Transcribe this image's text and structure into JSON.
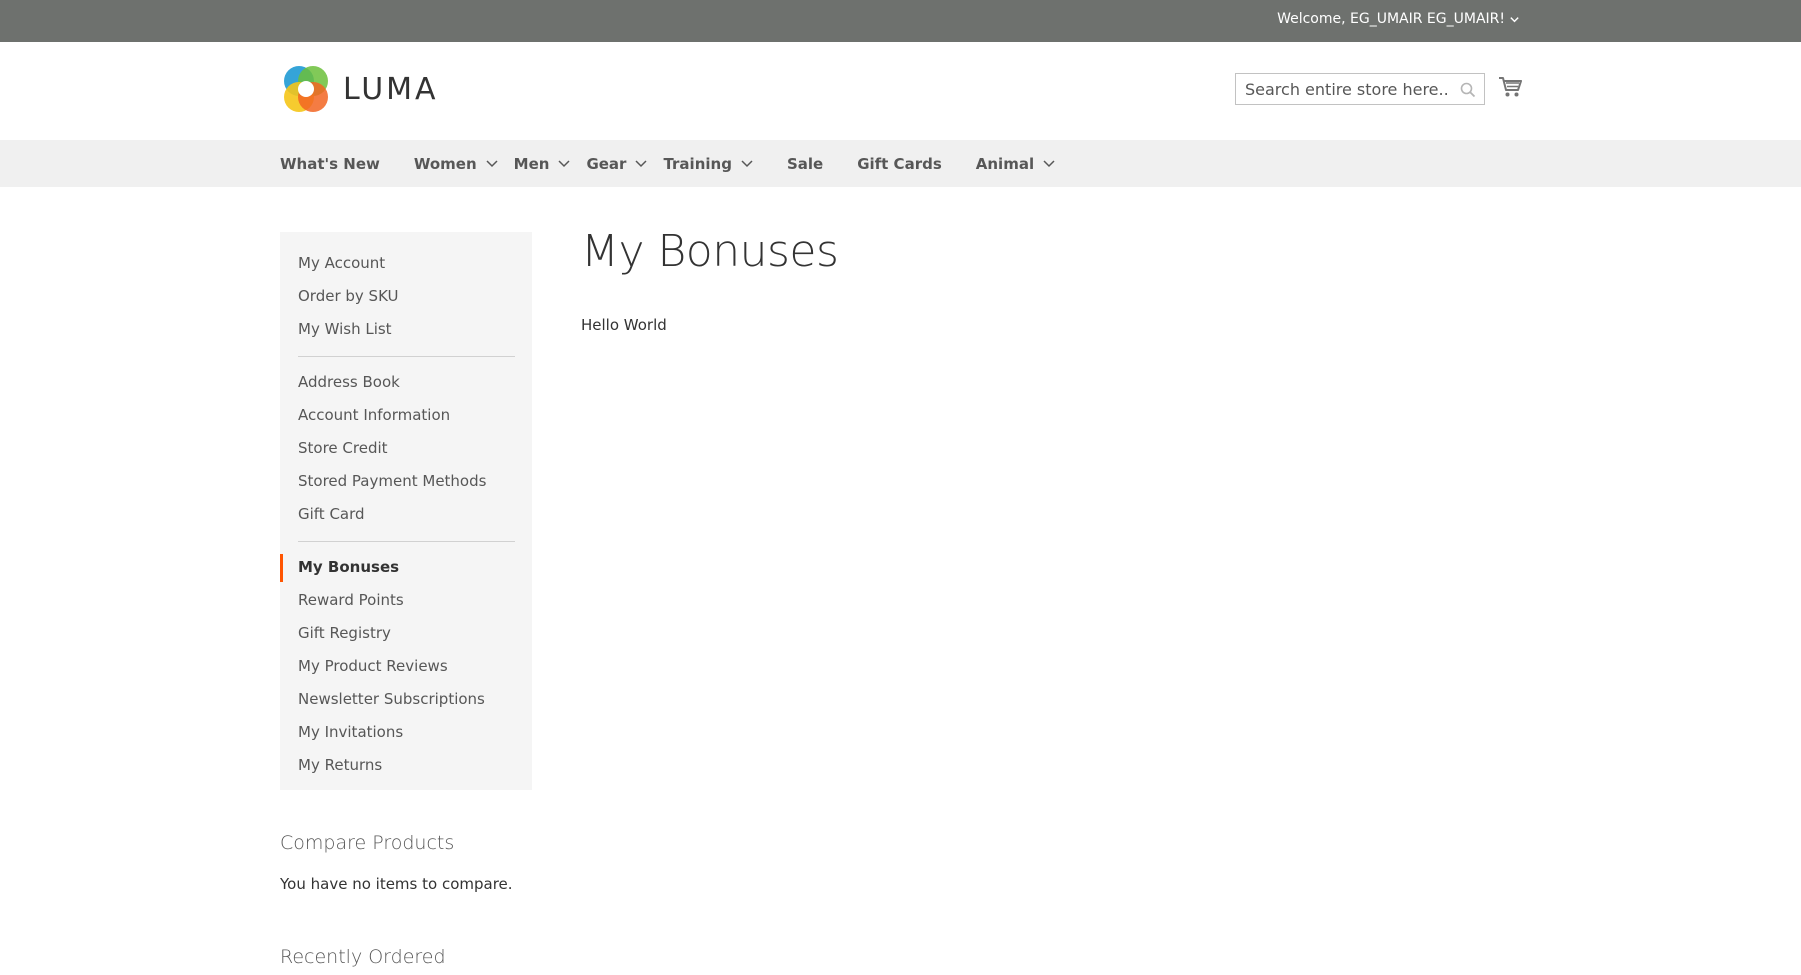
{
  "topbar": {
    "welcome": "Welcome, EG_UMAIR EG_UMAIR!"
  },
  "header": {
    "logo_text": "LUMA",
    "search_placeholder": "Search entire store here..."
  },
  "nav": {
    "items": [
      {
        "label": "What's New"
      },
      {
        "label": "Women"
      },
      {
        "label": "Men"
      },
      {
        "label": "Gear"
      },
      {
        "label": "Training"
      },
      {
        "label": "Sale"
      },
      {
        "label": "Gift Cards"
      },
      {
        "label": "Animal"
      }
    ]
  },
  "sidebar": {
    "group1": [
      {
        "label": "My Account"
      },
      {
        "label": "Order by SKU"
      },
      {
        "label": "My Wish List"
      }
    ],
    "group2": [
      {
        "label": "Address Book"
      },
      {
        "label": "Account Information"
      },
      {
        "label": "Store Credit"
      },
      {
        "label": "Stored Payment Methods"
      },
      {
        "label": "Gift Card"
      }
    ],
    "group3": [
      {
        "label": "My Bonuses"
      },
      {
        "label": "Reward Points"
      },
      {
        "label": "Gift Registry"
      },
      {
        "label": "My Product Reviews"
      },
      {
        "label": "Newsletter Subscriptions"
      },
      {
        "label": "My Invitations"
      },
      {
        "label": "My Returns"
      }
    ],
    "active_item": "My Bonuses",
    "accent_color": "#ff5501"
  },
  "main": {
    "title": "My Bonuses",
    "content": "Hello World"
  },
  "compare": {
    "title": "Compare Products",
    "empty_text": "You have no items to compare."
  },
  "recently_ordered": {
    "title": "Recently Ordered"
  },
  "colors": {
    "topbar_bg": "#6e716e",
    "nav_bg": "#f0f0f0",
    "sidebar_bg": "#f5f5f5"
  }
}
